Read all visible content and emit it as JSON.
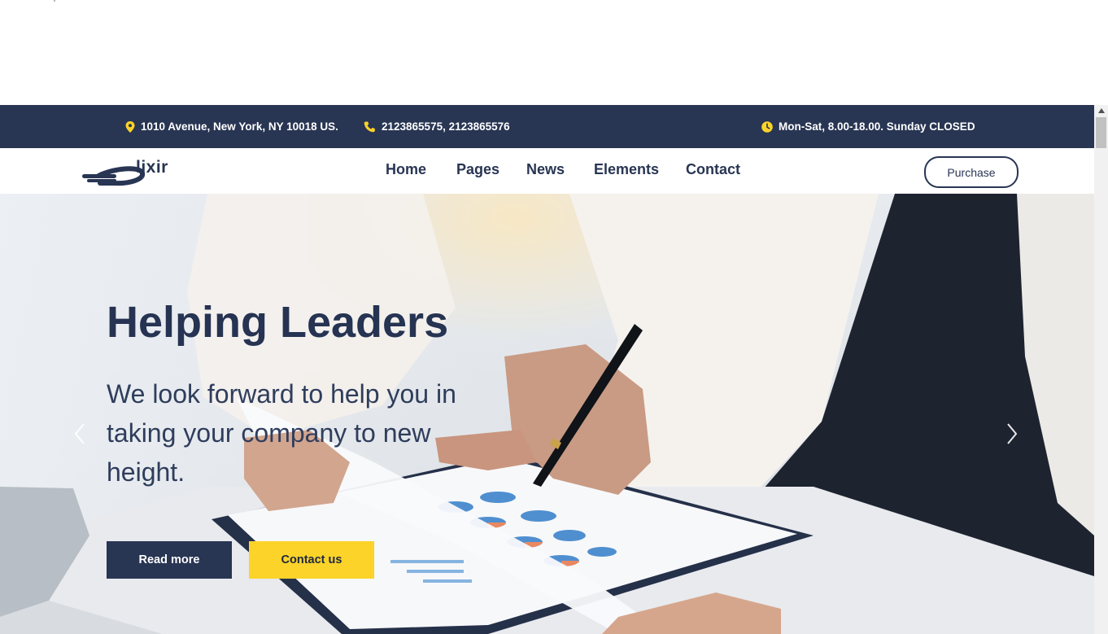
{
  "topbar": {
    "address": "1010 Avenue, New York, NY 10018 US.",
    "phone": "2123865575, 2123865576",
    "hours": "Mon-Sat, 8.00-18.00. Sunday CLOSED"
  },
  "brand": {
    "logo_text": "lixir"
  },
  "nav": {
    "items": [
      {
        "label": "Home"
      },
      {
        "label": "Pages"
      },
      {
        "label": "News"
      },
      {
        "label": "Elements"
      },
      {
        "label": "Contact"
      }
    ],
    "purchase_label": "Purchase"
  },
  "hero": {
    "title": "Helping Leaders",
    "subtitle": "We look forward to help you in taking your company to new height.",
    "read_more_label": "Read more",
    "contact_label": "Contact us"
  },
  "icons": {
    "address": "map-pin-icon",
    "phone": "phone-icon",
    "hours": "clock-icon"
  },
  "colors": {
    "navy": "#283553",
    "accent_yellow": "#fcd329",
    "white": "#ffffff"
  }
}
